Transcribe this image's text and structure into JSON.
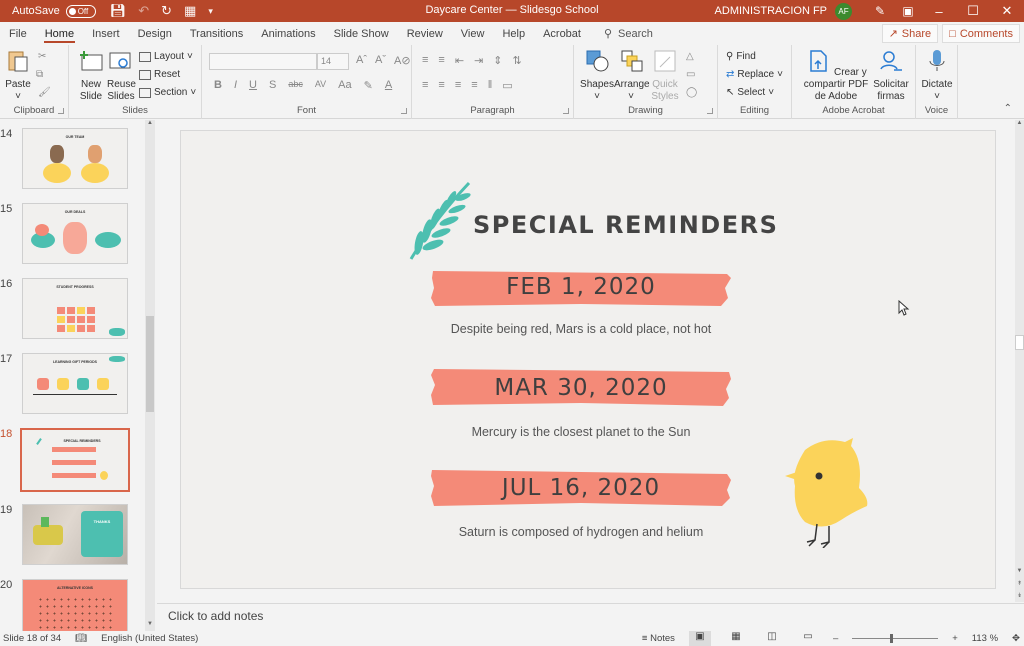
{
  "titlebar": {
    "autosave_label": "AutoSave",
    "autosave_state": "Off",
    "document_title": "Daycare Center — Slidesgo School",
    "user_name": "ADMINISTRACION FP",
    "user_initials": "AF",
    "qat_icons": [
      "save-icon",
      "undo-icon",
      "redo-icon",
      "present-icon",
      "customize-qat-icon"
    ]
  },
  "tabs": {
    "items": [
      "File",
      "Home",
      "Insert",
      "Design",
      "Transitions",
      "Animations",
      "Slide Show",
      "Review",
      "View",
      "Help",
      "Acrobat"
    ],
    "active": "Home",
    "search_label": "Search",
    "share_label": "Share",
    "comments_label": "Comments"
  },
  "ribbon": {
    "clipboard": {
      "label": "Clipboard",
      "paste": "Paste"
    },
    "slides": {
      "label": "Slides",
      "new_slide": "New Slide",
      "reuse_slides": "Reuse Slides",
      "layout": "Layout",
      "reset": "Reset",
      "section": "Section"
    },
    "font": {
      "label": "Font",
      "font_name": "",
      "font_size": "14",
      "format_buttons": [
        "B",
        "I",
        "U",
        "S",
        "abc",
        "AV",
        "Aa"
      ]
    },
    "paragraph": {
      "label": "Paragraph"
    },
    "drawing": {
      "label": "Drawing",
      "shapes": "Shapes",
      "arrange": "Arrange",
      "quick_styles": "Quick Styles"
    },
    "editing": {
      "label": "Editing",
      "find": "Find",
      "replace": "Replace",
      "select": "Select"
    },
    "acrobat": {
      "label": "Adobe Acrobat",
      "create_share": "Crear y compartir PDF de Adobe",
      "request_signatures": "Solicitar firmas"
    },
    "voice": {
      "label": "Voice",
      "dictate": "Dictate"
    }
  },
  "thumbnails": [
    {
      "number": "14",
      "title": "OUR TEAM",
      "active": false
    },
    {
      "number": "15",
      "title": "OUR DEALS",
      "active": false
    },
    {
      "number": "16",
      "title": "STUDENT PROGRESS",
      "active": false
    },
    {
      "number": "17",
      "title": "LEARNING GIFT PERIODS",
      "active": false
    },
    {
      "number": "18",
      "title": "SPECIAL REMINDERS",
      "active": true
    },
    {
      "number": "19",
      "title": "THANKS",
      "active": false
    },
    {
      "number": "20",
      "title": "ALTERNATIVE ICONS",
      "active": false
    }
  ],
  "slide": {
    "title": "SPECIAL REMINDERS",
    "reminders": [
      {
        "date": "FEB 1, 2020",
        "description": "Despite being red, Mars is a cold place, not hot"
      },
      {
        "date": "MAR 30, 2020",
        "description": "Mercury is the closest planet to the Sun"
      },
      {
        "date": "JUL 16, 2020",
        "description": "Saturn is composed of hydrogen and helium"
      }
    ],
    "colors": {
      "brush": "#f48a78",
      "leaf": "#4dbfb0",
      "chick": "#fbd35a",
      "background": "#f1f0ee"
    }
  },
  "notes": {
    "placeholder": "Click to add notes"
  },
  "status": {
    "slide_indicator": "Slide 18 of 34",
    "language": "English (United States)",
    "notes_label": "Notes",
    "zoom_percent": "113 %",
    "zoom_value": 113
  }
}
